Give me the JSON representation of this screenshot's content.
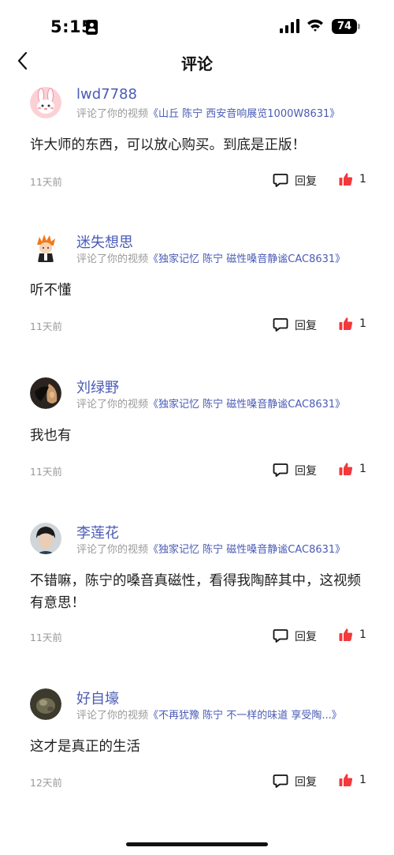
{
  "status_bar": {
    "time": "5:15",
    "battery": "74"
  },
  "nav": {
    "title": "评论",
    "back_icon": "chevron-left-icon"
  },
  "colors": {
    "username": "#4a5bb5",
    "like": "#f2393c",
    "muted": "#999999"
  },
  "comments": [
    {
      "user": "lwd7788",
      "prefix": "评论了你的视频",
      "video": "《山丘 陈宁 西安音响展览1000W8631》",
      "text": "许大师的东西，可以放心购买。到底是正版！",
      "time": "11天前",
      "reply_label": "回复",
      "likes": "1"
    },
    {
      "user": "迷失想思",
      "prefix": "评论了你的视频",
      "video": "《独家记忆 陈宁 磁性嗓音静谧CAC8631》",
      "text": "听不懂",
      "time": "11天前",
      "reply_label": "回复",
      "likes": "1"
    },
    {
      "user": "刘绿野",
      "prefix": "评论了你的视频",
      "video": "《独家记忆 陈宁 磁性嗓音静谧CAC8631》",
      "text": "我也有",
      "time": "11天前",
      "reply_label": "回复",
      "likes": "1"
    },
    {
      "user": "李莲花",
      "prefix": "评论了你的视频",
      "video": "《独家记忆 陈宁 磁性嗓音静谧CAC8631》",
      "text": "不错嘛，陈宁的嗓音真磁性，看得我陶醉其中，这视频有意思！",
      "time": "11天前",
      "reply_label": "回复",
      "likes": "1"
    },
    {
      "user": "好自壕",
      "prefix": "评论了你的视频",
      "video": "《不再犹豫 陈宁 不一样的味道 享受陶...》",
      "text": "这才是真正的生活",
      "time": "12天前",
      "reply_label": "回复",
      "likes": "1"
    }
  ]
}
